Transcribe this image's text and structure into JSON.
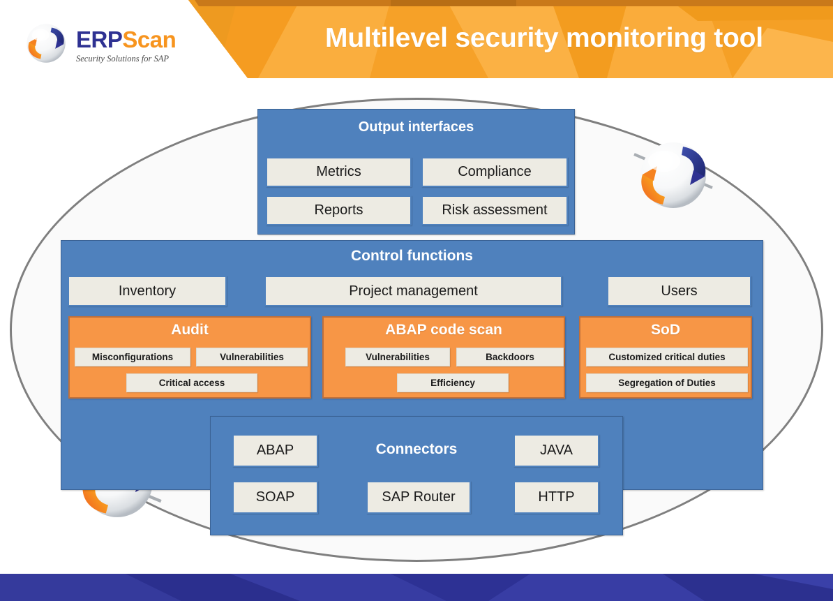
{
  "header": {
    "title": "Multilevel security monitoring tool",
    "brand": {
      "name_part1": "ERP",
      "name_part2": "Scan",
      "tagline": "Security Solutions for SAP",
      "logo_icon": "erpscan-sphere-icon"
    },
    "colors": {
      "orange_light": "#F9A93A",
      "orange_mid": "#F59E22",
      "orange_dark": "#E8891B",
      "brand_blue": "#2E3192",
      "brand_orange": "#F7941E"
    }
  },
  "diagram": {
    "shell_shape": "ellipse",
    "decorative_icons": [
      "erpscan-sphere-icon",
      "erpscan-sphere-icon"
    ],
    "colors": {
      "panel_blue": "#4F81BD",
      "panel_orange": "#F79646",
      "cell_bg": "#EDEBE3",
      "ellipse_stroke": "#7F7F7F"
    },
    "output_interfaces": {
      "title": "Output interfaces",
      "items": [
        {
          "label": "Metrics"
        },
        {
          "label": "Compliance"
        },
        {
          "label": "Reports"
        },
        {
          "label": "Risk assessment"
        }
      ]
    },
    "control_functions": {
      "title": "Control functions",
      "items": [
        {
          "label": "Inventory"
        },
        {
          "label": "Project management"
        },
        {
          "label": "Users"
        }
      ],
      "modules": [
        {
          "title": "Audit",
          "items": [
            {
              "label": "Misconfigurations"
            },
            {
              "label": "Vulnerabilities"
            },
            {
              "label": "Critical access"
            }
          ]
        },
        {
          "title": "ABAP code scan",
          "items": [
            {
              "label": "Vulnerabilities"
            },
            {
              "label": "Backdoors"
            },
            {
              "label": "Efficiency"
            }
          ]
        },
        {
          "title": "SoD",
          "items": [
            {
              "label": "Customized critical duties"
            },
            {
              "label": "Segregation of Duties"
            }
          ]
        }
      ]
    },
    "connectors": {
      "title": "Connectors",
      "items": [
        {
          "label": "ABAP"
        },
        {
          "label": "JAVA"
        },
        {
          "label": "SOAP"
        },
        {
          "label": "SAP Router"
        },
        {
          "label": "HTTP"
        }
      ]
    }
  },
  "footer": {
    "text": "",
    "color": "#2E3192"
  }
}
